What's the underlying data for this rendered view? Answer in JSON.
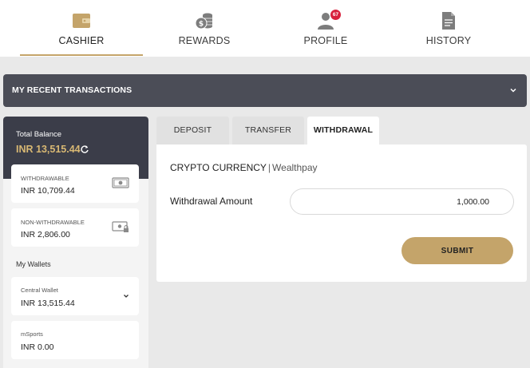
{
  "nav": {
    "items": [
      {
        "label": "CASHIER",
        "icon": "wallet-icon",
        "active": true
      },
      {
        "label": "REWARDS",
        "icon": "coins-icon",
        "active": false
      },
      {
        "label": "PROFILE",
        "icon": "user-icon",
        "active": false,
        "badge": "67"
      },
      {
        "label": "HISTORY",
        "icon": "document-icon",
        "active": false
      }
    ]
  },
  "recent_transactions": {
    "title": "MY RECENT TRANSACTIONS"
  },
  "balance": {
    "label": "Total Balance",
    "value": "INR 13,515.44"
  },
  "withdrawable": {
    "label": "WITHDRAWABLE",
    "amount": "INR 10,709.44"
  },
  "non_withdrawable": {
    "label": "NON-WITHDRAWABLE",
    "amount": "INR 2,806.00"
  },
  "my_wallets": {
    "label": "My Wallets"
  },
  "central_wallet": {
    "label": "Central Wallet",
    "amount": "INR 13,515.44"
  },
  "msports": {
    "label": "mSports",
    "amount": "INR 0.00"
  },
  "tabs": [
    {
      "label": "DEPOSIT",
      "active": false
    },
    {
      "label": "TRANSFER",
      "active": false
    },
    {
      "label": "WITHDRAWAL",
      "active": true
    }
  ],
  "withdrawal": {
    "method": "CRYPTO CURRENCY",
    "separator": "|",
    "provider": "Wealthpay",
    "amount_label": "Withdrawal Amount",
    "amount_value": "1,000.00",
    "submit_label": "SUBMIT"
  },
  "colors": {
    "accent": "#c4a46a",
    "dark_header": "#3b3d49",
    "bar": "#4b4d57",
    "balance_text": "#d8b873",
    "badge": "#d8203c"
  }
}
